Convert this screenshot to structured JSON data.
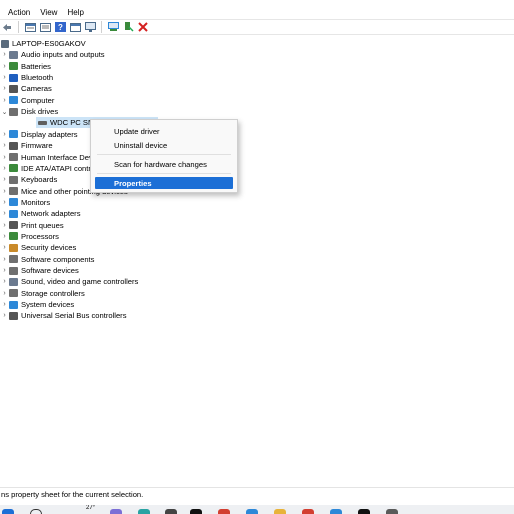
{
  "menu": [
    "Action",
    "View",
    "Help"
  ],
  "toolbar_icons": [
    "back-arrow-icon",
    "properties-grid-icon",
    "update-driver-icon",
    "help-icon",
    "view-icon",
    "monitor-icon",
    "scan-icon",
    "enable-device-icon",
    "uninstall-x-icon"
  ],
  "tree": {
    "root": "LAPTOP-ES0GAKOV",
    "categories": [
      {
        "label": "Audio inputs and outputs",
        "icon": "speaker-icon",
        "color": "#6b7a8f"
      },
      {
        "label": "Batteries",
        "icon": "battery-icon",
        "color": "#3b8a3b"
      },
      {
        "label": "Bluetooth",
        "icon": "bluetooth-icon",
        "color": "#1f5fbf"
      },
      {
        "label": "Cameras",
        "icon": "camera-icon",
        "color": "#555555"
      },
      {
        "label": "Computer",
        "icon": "computer-icon",
        "color": "#2d88d8"
      },
      {
        "label": "Disk drives",
        "icon": "disk-icon",
        "color": "#6f6f6f",
        "expanded": true
      },
      {
        "label": "Display adapters",
        "icon": "display-icon",
        "color": "#2d88d8"
      },
      {
        "label": "Firmware",
        "icon": "firmware-icon",
        "color": "#555555"
      },
      {
        "label": "Human Interface Devices",
        "icon": "hid-icon",
        "color": "#6f6f6f"
      },
      {
        "label": "IDE ATA/ATAPI controllers",
        "icon": "ide-icon",
        "color": "#3b8a3b"
      },
      {
        "label": "Keyboards",
        "icon": "keyboard-icon",
        "color": "#6f6f6f"
      },
      {
        "label": "Mice and other pointing devices",
        "icon": "mouse-icon",
        "color": "#6f6f6f"
      },
      {
        "label": "Monitors",
        "icon": "monitor-icon",
        "color": "#2d88d8"
      },
      {
        "label": "Network adapters",
        "icon": "network-icon",
        "color": "#2d88d8"
      },
      {
        "label": "Print queues",
        "icon": "printer-icon",
        "color": "#555555"
      },
      {
        "label": "Processors",
        "icon": "processor-icon",
        "color": "#3b8a3b"
      },
      {
        "label": "Security devices",
        "icon": "security-icon",
        "color": "#c98a2a"
      },
      {
        "label": "Software components",
        "icon": "software-component-icon",
        "color": "#6f6f6f"
      },
      {
        "label": "Software devices",
        "icon": "software-device-icon",
        "color": "#6f6f6f"
      },
      {
        "label": "Sound, video and game controllers",
        "icon": "sound-icon",
        "color": "#6b7a8f"
      },
      {
        "label": "Storage controllers",
        "icon": "storage-icon",
        "color": "#6f6f6f"
      },
      {
        "label": "System devices",
        "icon": "system-icon",
        "color": "#2d88d8"
      },
      {
        "label": "Universal Serial Bus controllers",
        "icon": "usb-icon",
        "color": "#555555"
      }
    ],
    "disk_child": "WDC PC SN530 S"
  },
  "context_menu": {
    "items": [
      "Update driver",
      "Uninstall device",
      "Scan for hardware changes",
      "Properties"
    ],
    "active": "Properties"
  },
  "status_text": "ns property sheet for the current selection.",
  "taskbar": {
    "weather": "27°"
  },
  "colors": {
    "selection": "#1c6fd6",
    "selected_row": "#cce4f7"
  }
}
